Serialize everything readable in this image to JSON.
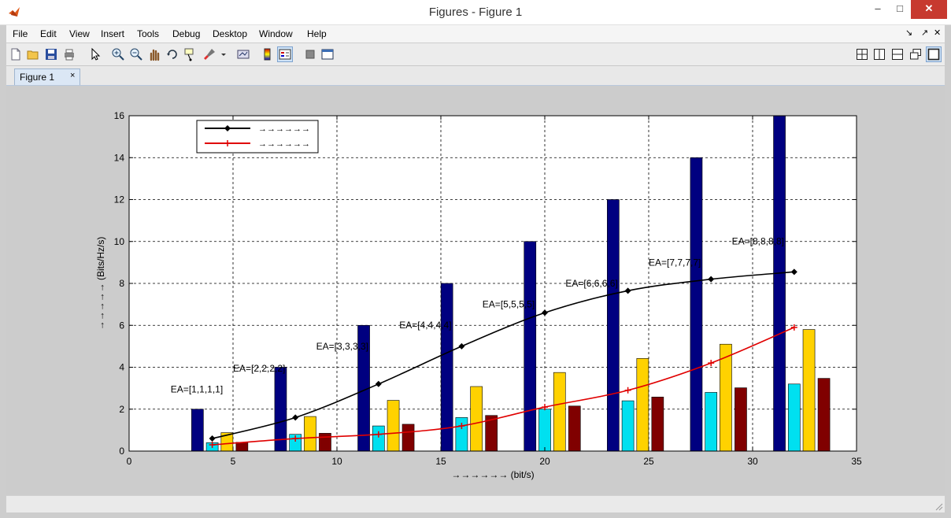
{
  "window": {
    "title": "Figures - Figure 1",
    "icon": "matlab-logo-icon",
    "min_glyph": "–",
    "max_glyph": "□",
    "close_glyph": "✕"
  },
  "menu": {
    "items": [
      {
        "label": "File"
      },
      {
        "label": "Edit"
      },
      {
        "label": "View"
      },
      {
        "label": "Insert"
      },
      {
        "label": "Tools"
      },
      {
        "label": "Debug"
      },
      {
        "label": "Desktop"
      },
      {
        "label": "Window"
      },
      {
        "label": "Help"
      }
    ],
    "right_controls": [
      "↘",
      "↗",
      "✕"
    ]
  },
  "toolbar": {
    "icons": [
      "new-figure-icon",
      "open-file-icon",
      "save-icon",
      "print-icon",
      "pointer-icon",
      "zoom-in-icon",
      "zoom-out-icon",
      "pan-icon",
      "rotate-3d-icon",
      "data-cursor-icon",
      "brush-icon",
      "link-plot-icon",
      "colorbar-icon",
      "legend-icon",
      "hide-plot-tools-icon",
      "show-plot-tools-icon"
    ],
    "layout_icons": [
      "tile-grid-icon",
      "tile-columns-icon",
      "tile-rows-icon",
      "float-icon",
      "dock-icon"
    ]
  },
  "tabs": [
    {
      "label": "Figure 1",
      "close": "×"
    }
  ],
  "chart_data": {
    "type": "bar",
    "title": "",
    "xlabel": "→→→→→→ (bit/s)",
    "ylabel": "→→→→→ (Bits/Hz/s)",
    "xlim": [
      0,
      35
    ],
    "ylim": [
      0,
      16
    ],
    "xticks": [
      0,
      5,
      10,
      15,
      20,
      25,
      30,
      35
    ],
    "yticks": [
      0,
      2,
      4,
      6,
      8,
      10,
      12,
      14,
      16
    ],
    "grid": true,
    "legend_position": "top-left",
    "groups": [
      4,
      8,
      12,
      16,
      20,
      24,
      28,
      32
    ],
    "bar_series": [
      {
        "color": "#000080",
        "values": [
          2,
          4,
          6,
          8,
          10,
          12,
          14,
          16
        ]
      },
      {
        "color": "#00e0f0",
        "values": [
          0.4,
          0.8,
          1.2,
          1.6,
          2.0,
          2.4,
          2.8,
          3.2
        ]
      },
      {
        "color": "#ffd200",
        "values": [
          0.88,
          1.65,
          2.42,
          3.08,
          3.75,
          4.42,
          5.1,
          5.8
        ]
      },
      {
        "color": "#800000",
        "values": [
          0.42,
          0.85,
          1.28,
          1.7,
          2.15,
          2.58,
          3.02,
          3.47
        ]
      }
    ],
    "line_series": [
      {
        "name": "→→→→→→",
        "color": "#000000",
        "x": [
          4,
          8,
          12,
          16,
          20,
          24,
          28,
          32
        ],
        "y": [
          0.6,
          1.6,
          3.2,
          5.0,
          6.6,
          7.65,
          8.2,
          8.55
        ]
      },
      {
        "name": "→→→→→→",
        "color": "#e00000",
        "x": [
          4,
          8,
          12,
          16,
          20,
          24,
          28,
          32
        ],
        "y": [
          0.3,
          0.6,
          0.8,
          1.2,
          2.1,
          2.9,
          4.2,
          5.9
        ]
      }
    ],
    "annotations": [
      {
        "text": "EA=[1,1,1,1]",
        "x": 2,
        "y": 2.8
      },
      {
        "text": "EA=[2,2,2,2]",
        "x": 5,
        "y": 3.8
      },
      {
        "text": "EA=[3,3,3,3]",
        "x": 9,
        "y": 4.85
      },
      {
        "text": "EA=[4,4,4,4]",
        "x": 13,
        "y": 5.85
      },
      {
        "text": "EA=[5,5,5,5]",
        "x": 17,
        "y": 6.85
      },
      {
        "text": "EA=[6,6,6,6]",
        "x": 21,
        "y": 7.85
      },
      {
        "text": "EA=[7,7,7,7]",
        "x": 25,
        "y": 8.85
      },
      {
        "text": "EA=[8,8,8,8]",
        "x": 29,
        "y": 9.85
      }
    ]
  }
}
